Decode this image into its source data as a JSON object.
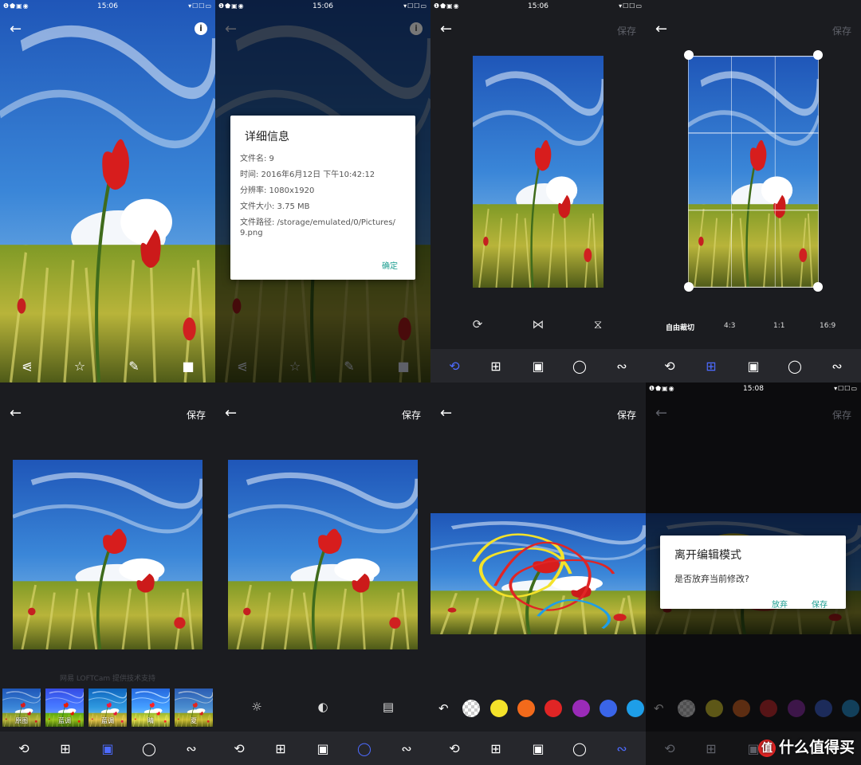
{
  "status": {
    "time_a": "15:06",
    "time_b": "15:08",
    "left_icons": "❶⬟▣◉",
    "right_icons": "▾☐☐▭"
  },
  "header": {
    "save_label": "保存"
  },
  "details_dialog": {
    "title": "详细信息",
    "rows": [
      "文件名: 9",
      "时间: 2016年6月12日 下午10:42:12",
      "分辨率: 1080x1920",
      "文件大小: 3.75 MB",
      "文件路径: /storage/emulated/0/Pictures/",
      "9.png"
    ],
    "confirm_label": "确定"
  },
  "crop": {
    "ratios": [
      "自由裁切",
      "4:3",
      "1:1",
      "16:9"
    ]
  },
  "filters": {
    "credit": "网易 LOFTCam 提供技术支持",
    "items": [
      "原图",
      "蓝调",
      "蓝调",
      "晴",
      "夏"
    ]
  },
  "brush_colors": [
    "#f4e22a",
    "#f26a1b",
    "#e02525",
    "#9a2bb8",
    "#3a65e8",
    "#1e9ee8"
  ],
  "exit_dialog": {
    "title": "离开编辑模式",
    "message": "是否放弃当前修改?",
    "discard_label": "放弃",
    "save_label": "保存"
  },
  "watermark": {
    "text": "什么值得买"
  },
  "icons": {
    "back": "arrow-left-icon",
    "info": "info-icon",
    "share": "share-icon",
    "favorite": "star-icon",
    "edit": "pencil-icon",
    "delete": "trash-icon",
    "rotate": "rotate-icon",
    "crop": "crop-icon",
    "filter": "filter-icon",
    "adjust": "adjust-icon",
    "draw": "draw-icon"
  },
  "colors": {
    "accent": "#4d6bff",
    "dialog_button": "#1a9d8f",
    "toolbar_bg": "#26272c",
    "screen_bg": "#1b1c20"
  }
}
